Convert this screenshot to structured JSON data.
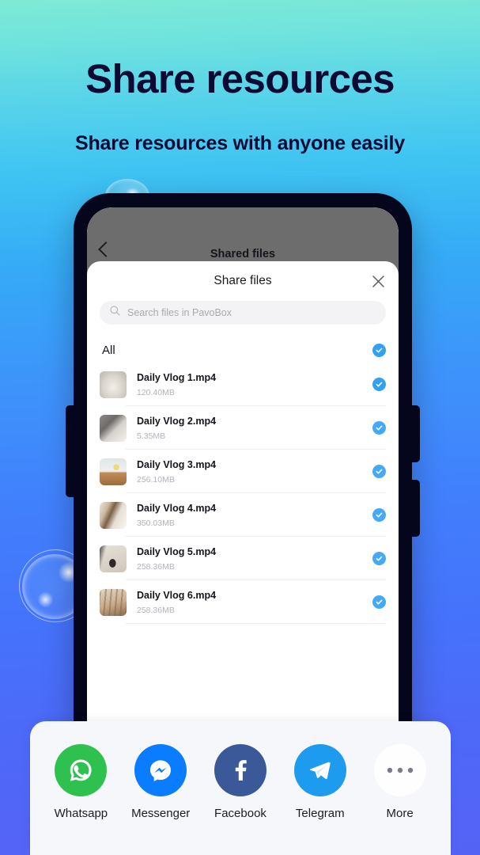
{
  "hero": {
    "headline": "Share resources",
    "subhead": "Share resources with anyone easily",
    "headline_color": "#0d0b33"
  },
  "background": {
    "gradient_top": "#7fead6",
    "gradient_mid": "#35aaf6",
    "gradient_bottom": "#5563f5"
  },
  "phone": {
    "app": {
      "title": "Shared files",
      "back_icon": "chevron-left-icon"
    },
    "sheet": {
      "title": "Share files",
      "close_icon": "close-icon",
      "search": {
        "icon": "search-icon",
        "placeholder": "Search files in PavoBox",
        "value": ""
      },
      "select_all": {
        "label": "All",
        "checked": true
      },
      "files": [
        {
          "name": "Daily Vlog 1.mp4",
          "size": "120.40MB",
          "checked": true,
          "thumb": "deer-skull-photo"
        },
        {
          "name": "Daily Vlog 2.mp4",
          "size": "5.35MB",
          "checked": true,
          "thumb": "grey-fabric-photo"
        },
        {
          "name": "Daily Vlog 3.mp4",
          "size": "256.10MB",
          "checked": true,
          "thumb": "banana-table-photo"
        },
        {
          "name": "Daily Vlog 4.mp4",
          "size": "350.03MB",
          "checked": true,
          "thumb": "framed-mirror-photo"
        },
        {
          "name": "Daily Vlog 5.mp4",
          "size": "258.36MB",
          "checked": true,
          "thumb": "camera-strap-photo"
        },
        {
          "name": "Daily Vlog 6.mp4",
          "size": "258.36MB",
          "checked": true,
          "thumb": "hanging-rack-photo"
        }
      ]
    }
  },
  "share_bar": {
    "targets": [
      {
        "label": "Whatsapp",
        "icon": "whatsapp-icon",
        "color": "#2ec14f"
      },
      {
        "label": "Messenger",
        "icon": "messenger-icon",
        "color": "#0a7cff"
      },
      {
        "label": "Facebook",
        "icon": "facebook-icon",
        "color": "#3b5998"
      },
      {
        "label": "Telegram",
        "icon": "telegram-icon",
        "color": "#1d9bef"
      },
      {
        "label": "More",
        "icon": "more-dots-icon",
        "color": "#ffffff"
      }
    ]
  },
  "accent_colors": {
    "checkbox_blue": "#34a0f2",
    "sheet_background": "#ffffff",
    "share_bar_background": "#f6f7fb"
  }
}
